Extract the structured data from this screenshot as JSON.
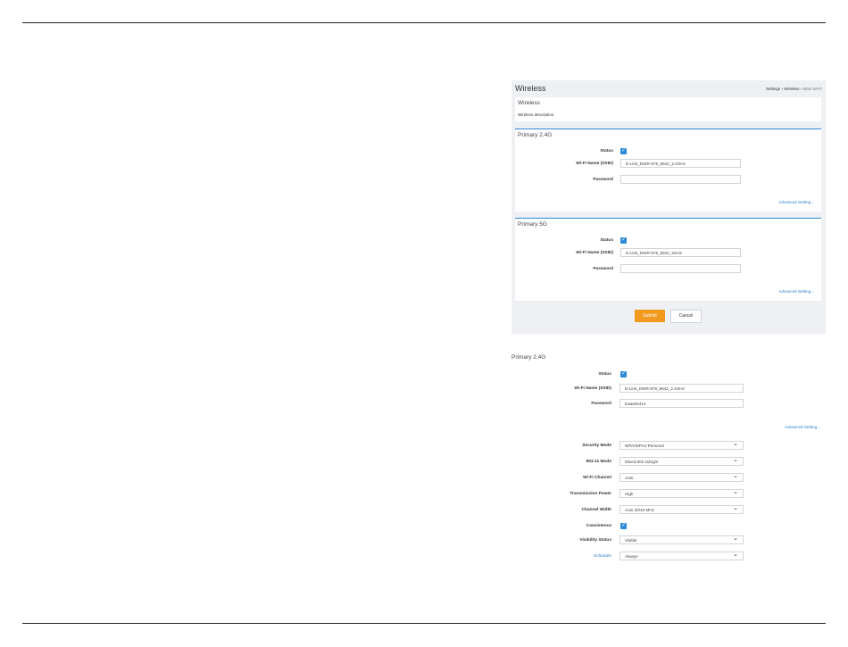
{
  "wireless_panel": {
    "title": "Wireless",
    "breadcrumb": {
      "settings": "Settings",
      "sep1": "›",
      "wireless": "Wireless",
      "sep2": "›",
      "current": "Main Wi-Fi"
    },
    "info_card": {
      "title": "Wireless",
      "description": "Wireless description."
    },
    "primary_24g": {
      "title": "Primary 2.4G",
      "status_label": "Status",
      "status_checked": true,
      "ssid_label": "Wi-Fi Name (SSID)",
      "ssid_value": "D-Link_DWR-978_8842_2.4GHz",
      "password_label": "Password",
      "password_value": "",
      "advanced_link": "Advanced Setting..."
    },
    "primary_5g": {
      "title": "Primary 5G",
      "status_label": "Status",
      "status_checked": true,
      "ssid_label": "Wi-Fi Name (SSID)",
      "ssid_value": "D-Link_DWR-978_8842_5GHz",
      "password_label": "Password",
      "password_value": "",
      "advanced_link": "Advanced Setting..."
    },
    "submit_label": "Submit",
    "cancel_label": "Cancel"
  },
  "detail": {
    "title": "Primary 2.4G",
    "status_label": "Status",
    "ssid_label": "Wi-Fi Name (SSID)",
    "ssid_value": "D-Link_DWR-978_8842_2.4GHz",
    "password_label": "Password",
    "password_value": "Eaaa63414",
    "advanced_link": "Advanced Setting...",
    "security_mode_label": "Security Mode",
    "security_mode_value": "WPA/WPA2-Personal",
    "mode_80211_label": "802.11 Mode",
    "mode_80211_value": "Mixed 802.11b/g/n",
    "channel_label": "Wi-Fi Channel",
    "channel_value": "Auto",
    "tx_power_label": "Transmission Power",
    "tx_power_value": "High",
    "channel_width_label": "Channel Width",
    "channel_width_value": "Auto 20/40 MHz",
    "coexistence_label": "Coexistence",
    "visibility_label": "Visibility Status",
    "visibility_value": "Visible",
    "schedule_label": "Schedule",
    "schedule_value": "Always"
  },
  "colors": {
    "accent": "#2b8ad8",
    "submit": "#f29a1f",
    "panel_bg": "#eef0f3"
  }
}
